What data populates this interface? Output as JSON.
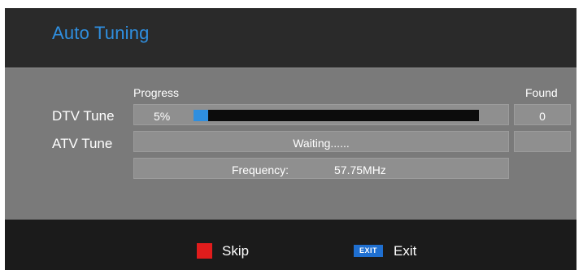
{
  "header": {
    "title": "Auto Tuning"
  },
  "columns": {
    "progress_label": "Progress",
    "found_label": "Found"
  },
  "dtv": {
    "label": "DTV Tune",
    "percent_text": "5%",
    "progress_fraction": 0.05,
    "found": "0"
  },
  "atv": {
    "label": "ATV Tune",
    "status": "Waiting......",
    "found": ""
  },
  "frequency": {
    "label": "Frequency:",
    "value": "57.75MHz"
  },
  "footer": {
    "skip": {
      "key_color": "#e11c1c",
      "label": "Skip",
      "icon": "red-square-icon"
    },
    "exit": {
      "key_text": "EXIT",
      "key_color": "#1f6fd0",
      "label": "Exit"
    }
  },
  "colors": {
    "accent": "#2f8fe0",
    "panel": "#7a7a7a",
    "cell": "#8f8f8f",
    "header": "#2a2a2a",
    "footer": "#1b1b1b"
  }
}
